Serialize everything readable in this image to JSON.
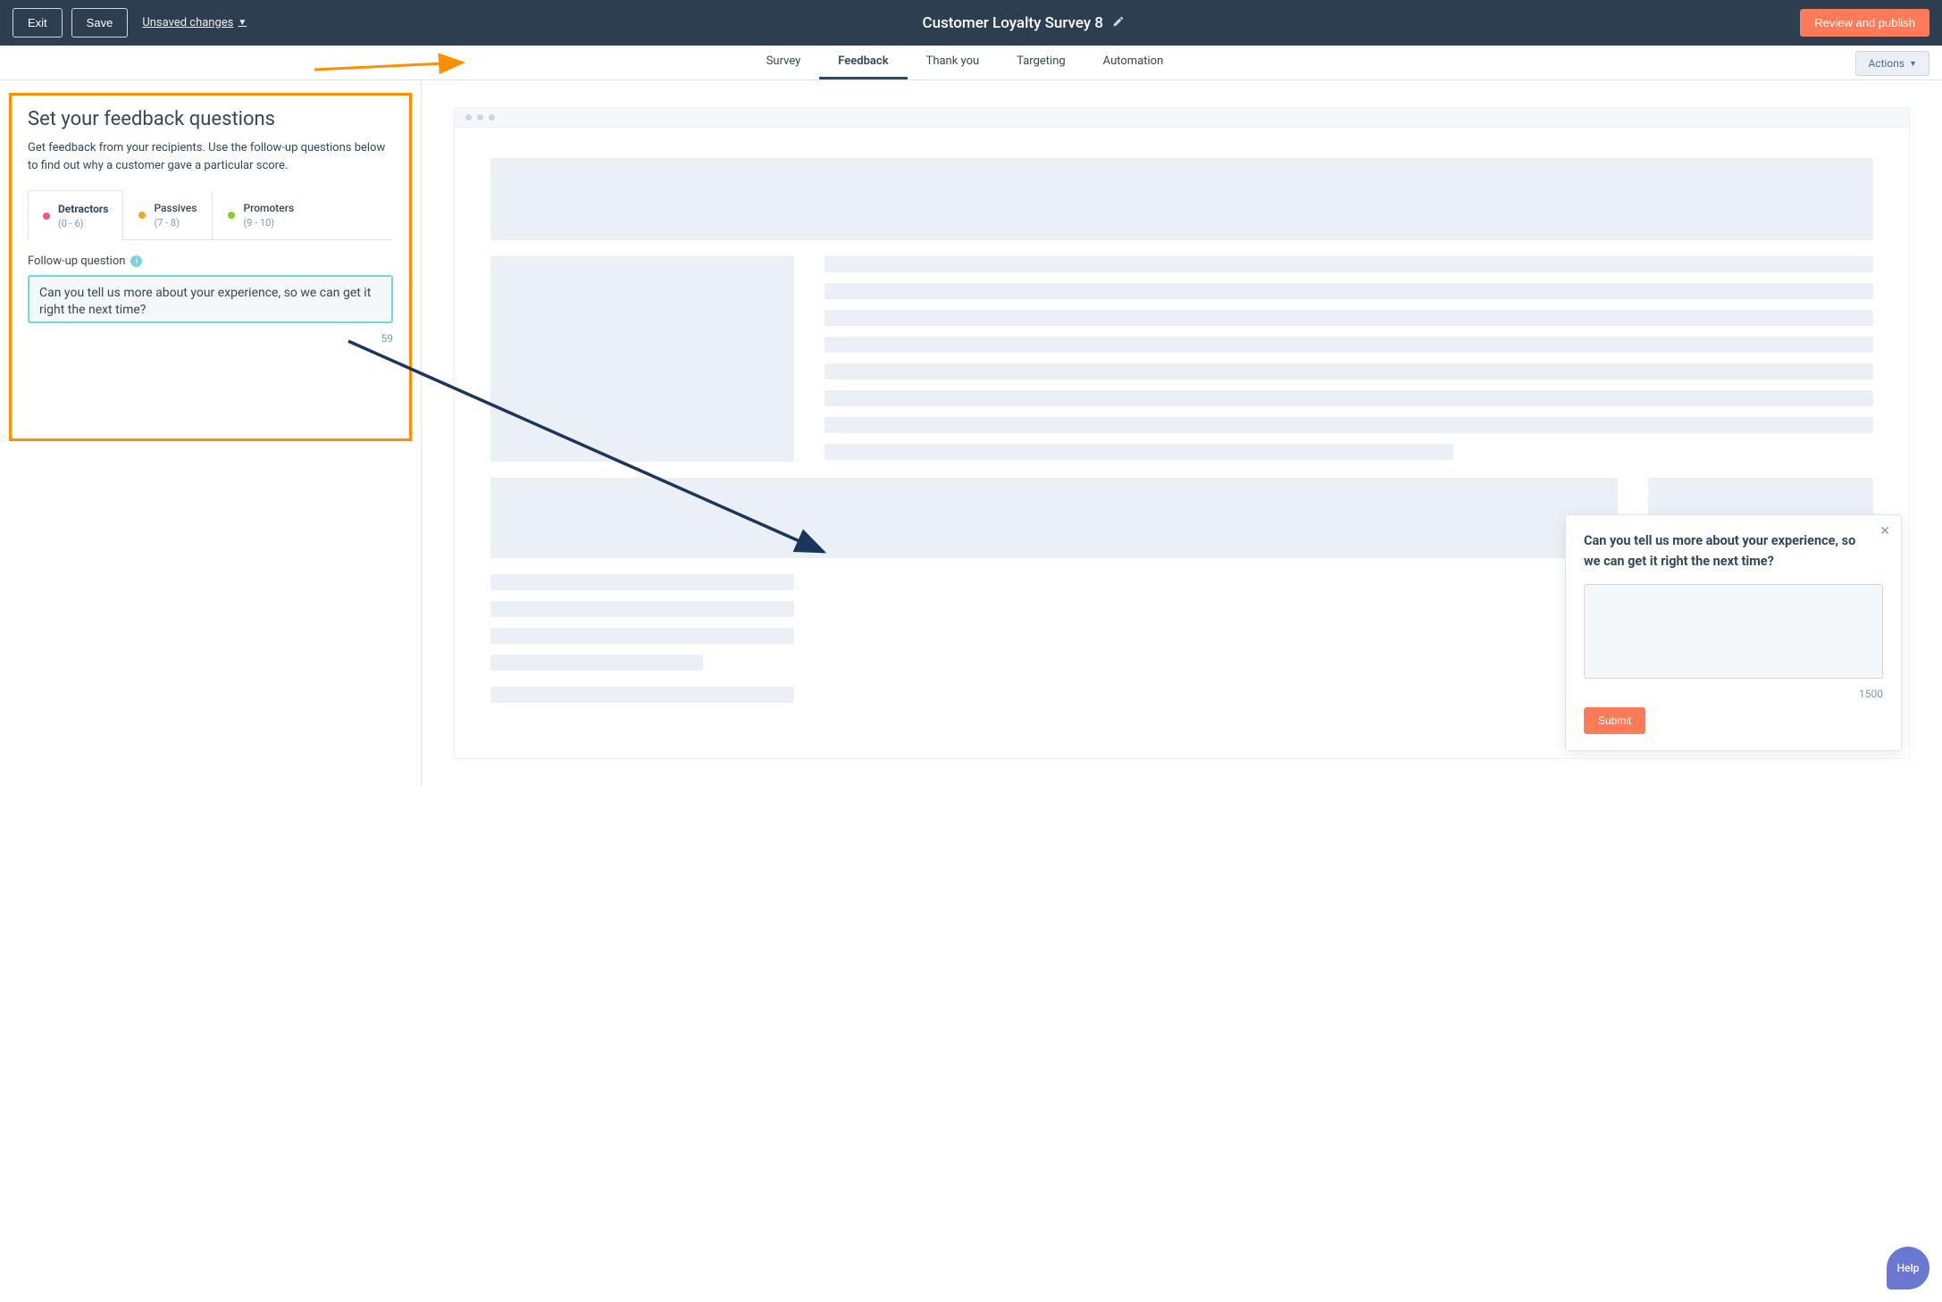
{
  "header": {
    "exit_label": "Exit",
    "save_label": "Save",
    "unsaved_label": "Unsaved changes",
    "title": "Customer Loyalty Survey 8",
    "publish_label": "Review and publish"
  },
  "tabs": {
    "items": [
      "Survey",
      "Feedback",
      "Thank you",
      "Targeting",
      "Automation"
    ],
    "active": "Feedback",
    "actions_label": "Actions"
  },
  "panel": {
    "title": "Set your feedback questions",
    "description": "Get feedback from your recipients. Use the follow-up questions below to find out why a customer gave a particular score.",
    "segments": [
      {
        "label": "Detractors",
        "range": "(0 - 6)",
        "color": "#f2547d",
        "active": true
      },
      {
        "label": "Passives",
        "range": "(7 - 8)",
        "color": "#f5a623",
        "active": false
      },
      {
        "label": "Promoters",
        "range": "(9 - 10)",
        "color": "#7ed321",
        "active": false
      }
    ],
    "followup_label": "Follow-up question",
    "followup_value": "Can you tell us more about your experience, so we can get it right the next time?",
    "char_count": "59"
  },
  "popup": {
    "question": "Can you tell us more about your experience, so we can get it right the next time?",
    "char_limit": "1500",
    "submit_label": "Submit"
  },
  "help_label": "Help"
}
